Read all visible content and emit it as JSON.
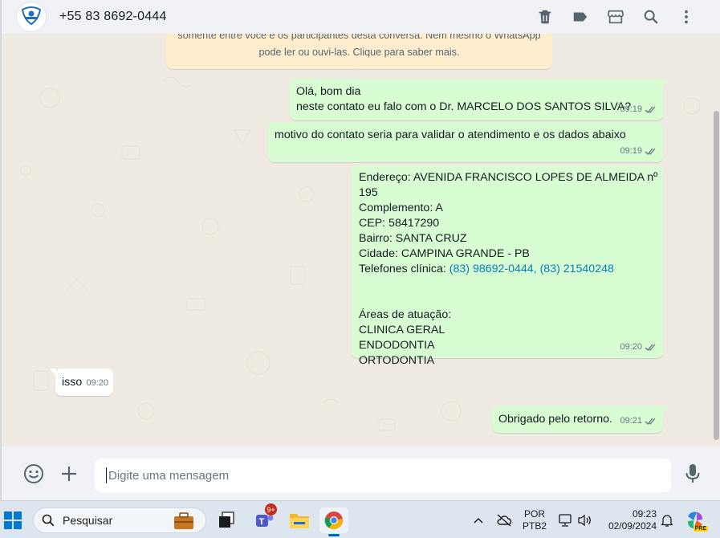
{
  "header": {
    "contact_name": "+55 83 8692-0444",
    "icons": [
      "delete-icon",
      "label-icon",
      "store-icon",
      "search-icon",
      "menu-icon"
    ]
  },
  "notice": {
    "line1": "somente entre você e os participantes desta conversa. Nem mesmo o WhatsApp",
    "line2": "pode ler ou ouvi-las. Clique para saber mais."
  },
  "messages": [
    {
      "direction": "out",
      "lines": [
        "Olá, bom dia",
        "neste contato eu falo com o Dr. MARCELO DOS SANTOS SILVA?"
      ],
      "time": "09:19",
      "status": "read"
    },
    {
      "direction": "out",
      "lines": [
        "motivo do contato seria para validar o atendimento e os dados abaixo"
      ],
      "time": "09:19",
      "status": "read"
    },
    {
      "direction": "out",
      "lines": [
        "Endereço: AVENIDA FRANCISCO LOPES DE ALMEIDA nº 195",
        "Complemento: A",
        "CEP: 58417290",
        "Bairro: SANTA CRUZ",
        "Cidade: CAMPINA GRANDE - PB",
        "Telefones clínica: ",
        "",
        "",
        "Áreas de atuação:",
        "CLINICA GERAL",
        "ENDODONTIA",
        "ORTODONTIA"
      ],
      "phone_links": "(83) 98692-0444, (83) 21540248",
      "time": "09:20",
      "status": "read"
    },
    {
      "direction": "in",
      "lines": [
        "isso"
      ],
      "time": "09:20"
    },
    {
      "direction": "out",
      "lines": [
        "Obrigado pelo retorno."
      ],
      "time": "09:21",
      "status": "read"
    }
  ],
  "composer": {
    "placeholder": "Digite uma mensagem",
    "icons": [
      "emoji-icon",
      "plus-icon",
      "microphone-icon"
    ]
  },
  "taskbar": {
    "search_label": "Pesquisar",
    "teams_badge": "9+",
    "lang_top": "POR",
    "lang_bottom": "PTB2",
    "time": "09:23",
    "date": "02/09/2024",
    "copilot_badge": "PRE"
  },
  "colors": {
    "outgoing_bubble": "#d9fdd3",
    "incoming_bubble": "#ffffff",
    "chat_background": "#efeae2",
    "notice_background": "#ffeecd",
    "link": "#027eb5",
    "read_check": "#667781"
  }
}
